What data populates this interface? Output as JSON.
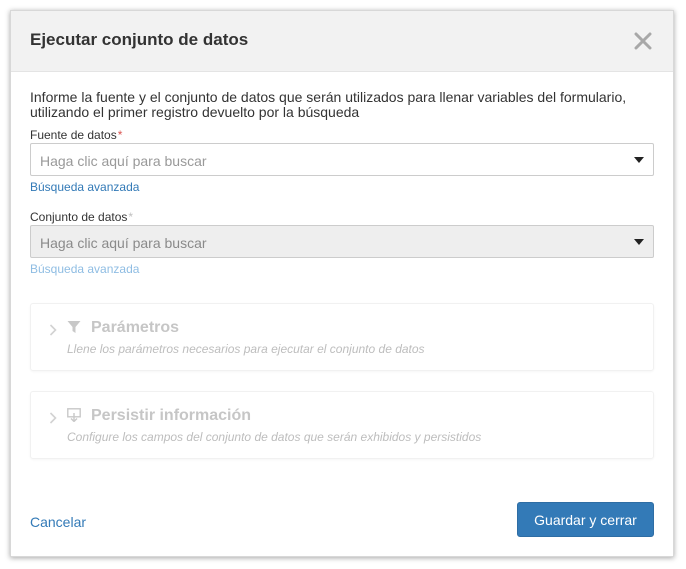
{
  "dialog": {
    "title": "Ejecutar conjunto de datos",
    "close_icon": "close-icon",
    "intro": "Informe la fuente y el conjunto de datos que serán utilizados para llenar variables del formulario, utilizando el primer registro devuelto por la búsqueda"
  },
  "fields": {
    "data_source": {
      "label": "Fuente de datos",
      "required_mark": "*",
      "placeholder": "Haga clic aquí para buscar",
      "advanced_link": "Búsqueda avanzada"
    },
    "dataset": {
      "label": "Conjunto de datos",
      "required_mark": "*",
      "placeholder": "Haga clic aquí para buscar",
      "advanced_link": "Búsqueda avanzada",
      "disabled": true
    }
  },
  "sections": {
    "parameters": {
      "icon": "filter-icon",
      "title": "Parámetros",
      "subtitle": "Llene los parámetros necesarios para ejecutar el conjunto de datos"
    },
    "persist": {
      "icon": "persist-icon",
      "title": "Persistir información",
      "subtitle": "Configure los campos del conjunto de datos que serán exhibidos y persistidos"
    }
  },
  "footer": {
    "cancel_label": "Cancelar",
    "save_label": "Guardar y cerrar"
  },
  "colors": {
    "primary": "#337ab7",
    "required": "#d9534f",
    "header_bg": "#f2f2f2"
  }
}
